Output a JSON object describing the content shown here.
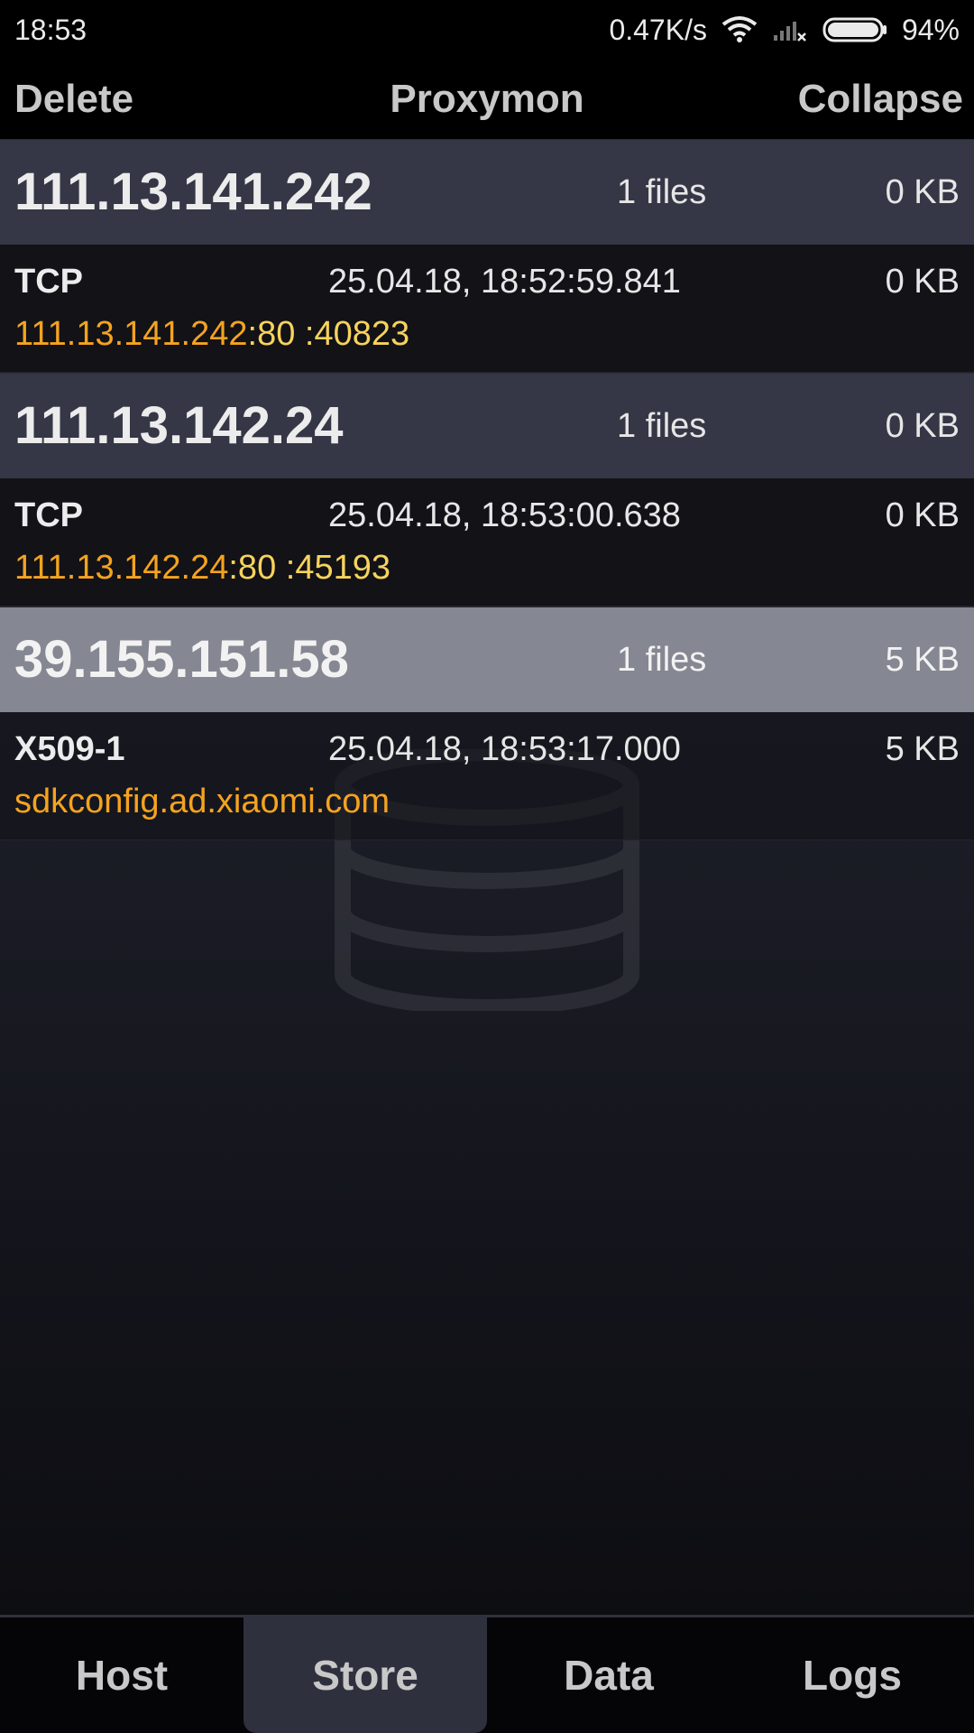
{
  "status_bar": {
    "time": "18:53",
    "network_speed": "0.47K/s",
    "wifi_icon": "wifi-icon",
    "signal_icon": "signal-no-service-icon",
    "battery_icon": "battery-icon",
    "battery_percent": "94%"
  },
  "action_bar": {
    "left": "Delete",
    "title": "Proxymon",
    "right": "Collapse"
  },
  "groups": [
    {
      "host": "111.13.141.242",
      "files": "1 files",
      "size": "0 KB",
      "selected": false,
      "entries": [
        {
          "protocol": "TCP",
          "timestamp": "25.04.18, 18:52:59.841",
          "size": "0 KB",
          "address": "111.13.141.242",
          "port": ":80 :40823"
        }
      ]
    },
    {
      "host": "111.13.142.24",
      "files": "1 files",
      "size": "0 KB",
      "selected": false,
      "entries": [
        {
          "protocol": "TCP",
          "timestamp": "25.04.18, 18:53:00.638",
          "size": "0 KB",
          "address": "111.13.142.24",
          "port": ":80 :45193"
        }
      ]
    },
    {
      "host": "39.155.151.58",
      "files": "1 files",
      "size": "5 KB",
      "selected": true,
      "entries": [
        {
          "protocol": "X509-1",
          "timestamp": "25.04.18, 18:53:17.000",
          "size": "5 KB",
          "address": "sdkconfig.ad.xiaomi.com",
          "port": ""
        }
      ]
    }
  ],
  "bottom_nav": {
    "tabs": [
      "Host",
      "Store",
      "Data",
      "Logs"
    ],
    "active": "Store"
  },
  "colors": {
    "accent_orange": "#f5a31f",
    "accent_yellow": "#f7d35c",
    "group_header": "#353746",
    "group_header_selected": "#858792"
  }
}
